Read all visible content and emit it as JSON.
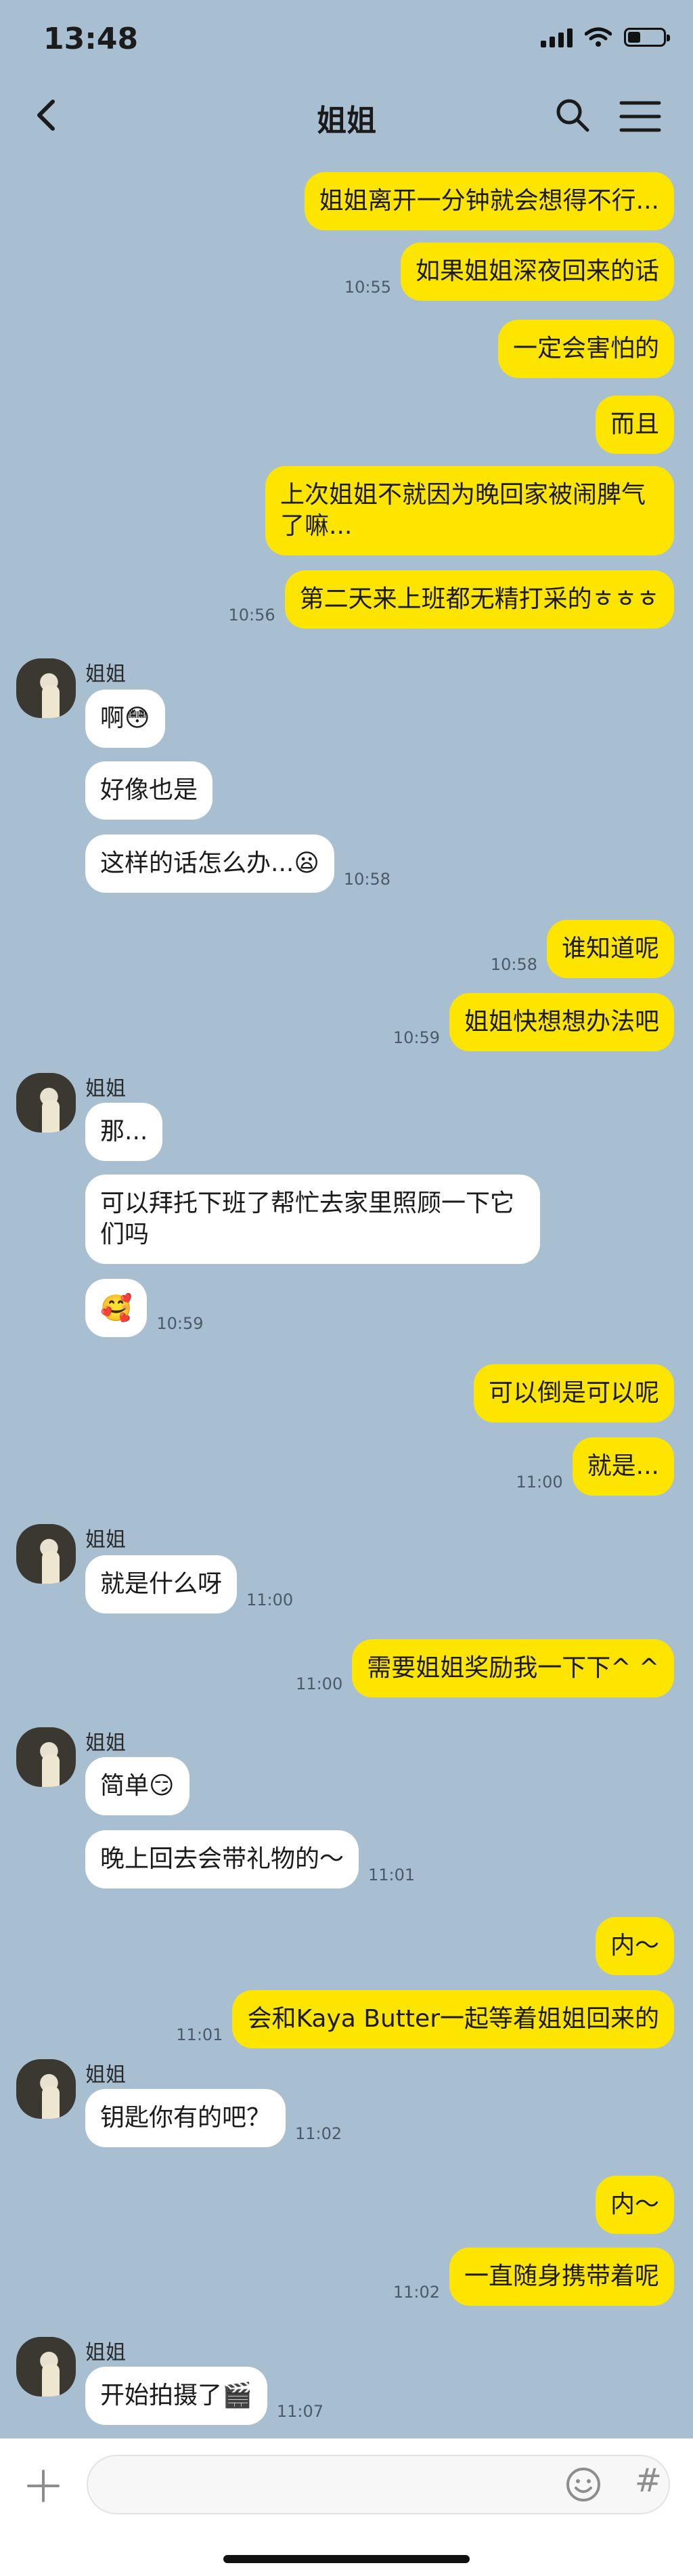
{
  "status": {
    "time": "13:48",
    "battery_level": 0.35
  },
  "header": {
    "title": "姐姐",
    "back_icon": "chevron-left-icon",
    "search_icon": "search-icon",
    "menu_icon": "menu-icon"
  },
  "messages": [
    {
      "text": "姐姐离开一分钟就会想得不行...",
      "time": ""
    },
    {
      "text": "如果姐姐深夜回来的话",
      "time": "10:55"
    },
    {
      "text": "一定会害怕的",
      "time": ""
    },
    {
      "text": "而且",
      "time": ""
    },
    {
      "text": "上次姐姐不就因为晚回家被闹脾气了嘛...",
      "time": ""
    },
    {
      "text": "第二天来上班都无精打采的ㅎㅎㅎ",
      "time": "10:56"
    },
    {
      "sender": "姐姐",
      "text": "啊😳",
      "time": ""
    },
    {
      "text": "好像也是",
      "time": ""
    },
    {
      "text": "这样的话怎么办...😦",
      "time": "10:58"
    },
    {
      "text": "谁知道呢",
      "time": "10:58"
    },
    {
      "text": "姐姐快想想办法吧",
      "time": "10:59"
    },
    {
      "sender": "姐姐",
      "text": "那...",
      "time": ""
    },
    {
      "text": "可以拜托下班了帮忙去家里照顾一下它们吗",
      "time": ""
    },
    {
      "text": "🥰",
      "time": "10:59"
    },
    {
      "text": "可以倒是可以呢",
      "time": ""
    },
    {
      "text": "就是...",
      "time": "11:00"
    },
    {
      "sender": "姐姐",
      "text": "就是什么呀",
      "time": "11:00"
    },
    {
      "text": "需要姐姐奖励我一下下^ ^",
      "time": "11:00"
    },
    {
      "sender": "姐姐",
      "text": "简单😏",
      "time": ""
    },
    {
      "text": "晚上回去会带礼物的～",
      "time": "11:01"
    },
    {
      "text": "内～",
      "time": ""
    },
    {
      "text": "会和Kaya Butter一起等着姐姐回来的",
      "time": "11:01"
    },
    {
      "sender": "姐姐",
      "text": "钥匙你有的吧？",
      "time": "11:02"
    },
    {
      "text": "内～",
      "time": ""
    },
    {
      "text": "一直随身携带着呢",
      "time": "11:02"
    },
    {
      "sender": "姐姐",
      "text": "开始拍摄了🎬",
      "time": "11:07"
    }
  ],
  "input_bar": {
    "placeholder": "",
    "plus_icon": "plus-icon",
    "emoji_icon": "emoji-icon",
    "hash_label": "#"
  }
}
